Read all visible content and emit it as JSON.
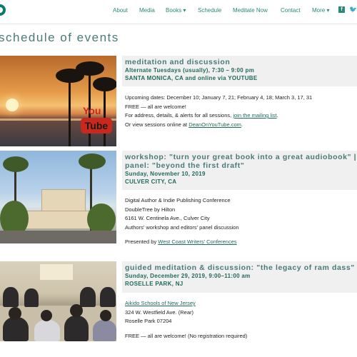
{
  "nav": {
    "items": [
      "About",
      "Media",
      "Books ▾",
      "Schedule",
      "Meditate Now",
      "Contact",
      "More ▾"
    ],
    "social": [
      "facebook-icon",
      "twitter-icon"
    ]
  },
  "page": {
    "title": "schedule of events"
  },
  "events": [
    {
      "title": "meditation and discussion",
      "date": "Alternate Tuesdays (usually), 7:30 – 9:00 pm",
      "place": "SANTA MONICA, CA and online via YOUTUBE",
      "image_badge": {
        "line1": "You",
        "line2": "Tube"
      },
      "body": {
        "line1": "Upcoming dates: December 10; January 7, 21; February 4, 18; March 3, 17, 31",
        "line2": "FREE — all are welcome!",
        "line3_pre": "For address, details, & alerts for all sessions, ",
        "line3_link": "join the mailing list",
        "line3_post": ".",
        "line4_pre": "Or view sessions online at ",
        "line4_link": "DeanOnYouTube.com",
        "line4_post": "."
      }
    },
    {
      "title_line1": "workshop: \"turn your great book into a great audiobook\" |",
      "title_line2": "panel: \"beyond the first draft\"",
      "date": "Sunday, November 10, 2019",
      "place": "CULVER CITY, CA",
      "body": {
        "line1": "Digital Author & Indie Publishing Conference",
        "line2": "DoubleTree by Hilton",
        "line3": "6161 W. Centinela Ave., Culver City",
        "line4": "Authors' workshop and editors' panel discussion",
        "line5_pre": "Presented by ",
        "line5_link": "West Coast Writers' Conferences"
      }
    },
    {
      "title": "guided meditation & discussion: \"the legacy of ram dass\"",
      "date": "Sunday, December 29, 2019, 9:00–11:00 am",
      "place": "ROSELLE PARK, NJ",
      "body": {
        "line1_link": "Aikido Schools of New Jersey",
        "line2": "324 W. Westfield Ave. (Rear)",
        "line3": "Roselle Park 07204",
        "line4": "FREE — all are welcome! (No registration required)"
      }
    }
  ]
}
